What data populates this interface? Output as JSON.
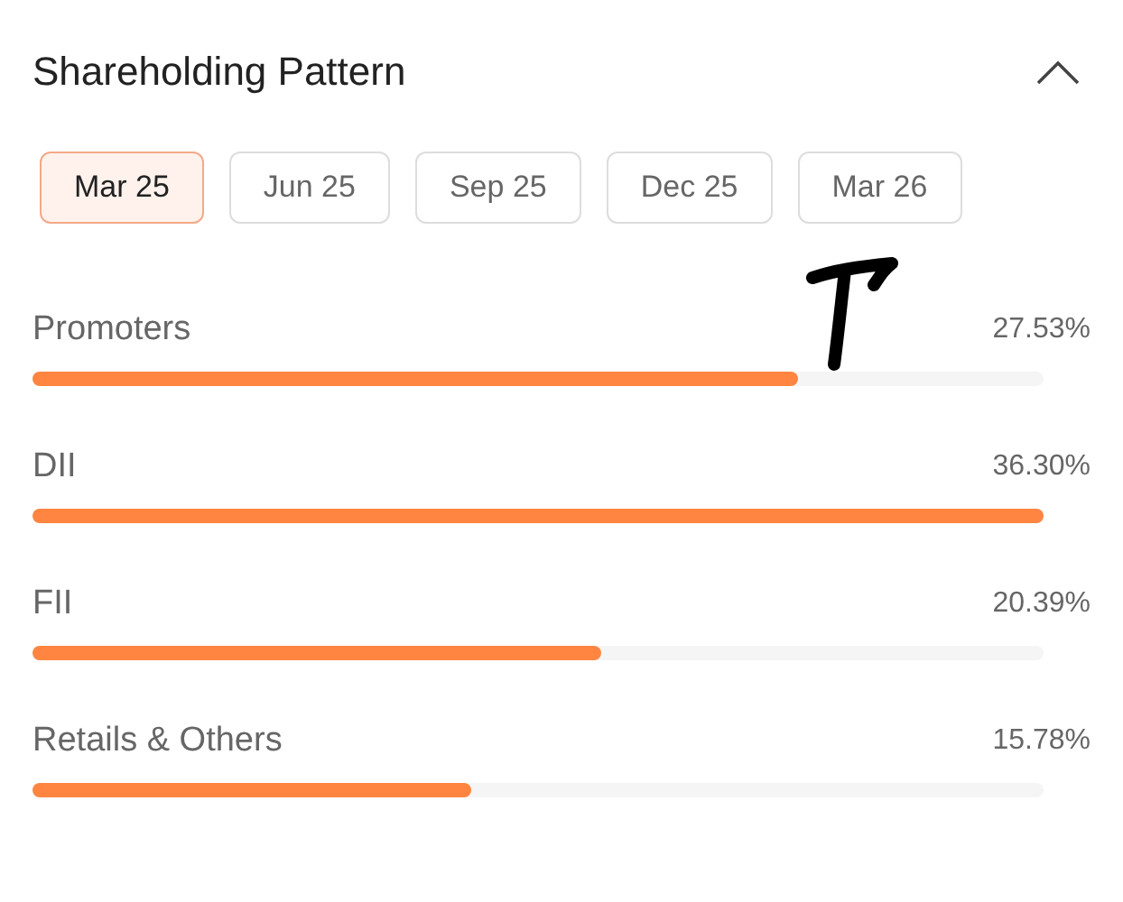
{
  "title": "Shareholding Pattern",
  "expanded": true,
  "tabs": [
    {
      "label": "Mar 25",
      "selected": true
    },
    {
      "label": "Jun 25",
      "selected": false
    },
    {
      "label": "Sep 25",
      "selected": false
    },
    {
      "label": "Dec 25",
      "selected": false
    },
    {
      "label": "Mar 26",
      "selected": false
    }
  ],
  "holders": [
    {
      "name": "Promoters",
      "value": "27.53%",
      "level": 0.758
    },
    {
      "name": "DII",
      "value": "36.30%",
      "level": 1
    },
    {
      "name": "FII",
      "value": "20.39%",
      "level": 0.562
    },
    {
      "name": "Retails & Others",
      "value": "15.78%",
      "level": 0.434
    }
  ]
}
